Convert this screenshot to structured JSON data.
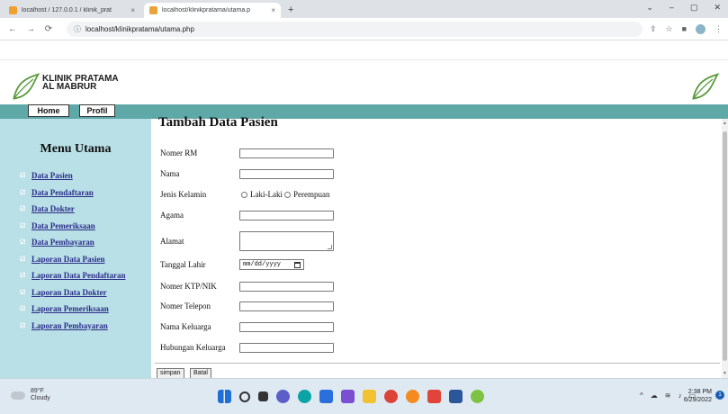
{
  "browser": {
    "tabs": [
      {
        "title": "localhost / 127.0.0.1 / klinik_prat",
        "close": "×"
      },
      {
        "title": "localhost/klinikpratama/utama.p",
        "close": "×"
      }
    ],
    "new_tab": "+",
    "url": "localhost/klinikpratama/utama.php",
    "window_controls": {
      "min": "–",
      "max": "▢",
      "close": "✕",
      "chevron": "⌄"
    }
  },
  "site": {
    "brand_line1": "KLINIK PRATAMA",
    "brand_line2": "AL MABRUR",
    "nav": {
      "home": "Home",
      "profil": "Profil"
    },
    "accent_color": "#5fa8a8",
    "sidebar_color": "#b8e0e6"
  },
  "sidebar": {
    "title": "Menu Utama",
    "items": [
      "Data Pasien",
      "Data Pendaftaran",
      "Data Dokter",
      "Data Pemeriksaan",
      "Data Pembayaran",
      "Laporan Data Pasien",
      "Laporan Data Pendaftaran",
      "Laporan Data Dokter",
      "Laporan Pemeriksaan",
      "Laporan Pembayaran"
    ]
  },
  "form": {
    "title": "Tambah Data Pasien",
    "labels": {
      "nomer_rm": "Nomer RM",
      "nama": "Nama",
      "jenis_kelamin": "Jenis Kelamin",
      "agama": "Agama",
      "alamat": "Alamat",
      "tanggal_lahir": "Tanggal Lahir",
      "nomer_ktp": "Nomer KTP/NIK",
      "nomer_telepon": "Nomer Telepon",
      "nama_keluarga": "Nama Keluarga",
      "hubungan_keluarga": "Hubungan Keluarga"
    },
    "gender_options": [
      "Laki-Laki",
      "Perempuan"
    ],
    "date_placeholder": "mm/dd/yyyy",
    "buttons": {
      "save": "simpan",
      "cancel": "Batal"
    }
  },
  "taskbar": {
    "temp": "89°F",
    "weather": "Cloudy",
    "time": "2:38 PM",
    "date": "6/29/2022",
    "notif_count": "1"
  }
}
